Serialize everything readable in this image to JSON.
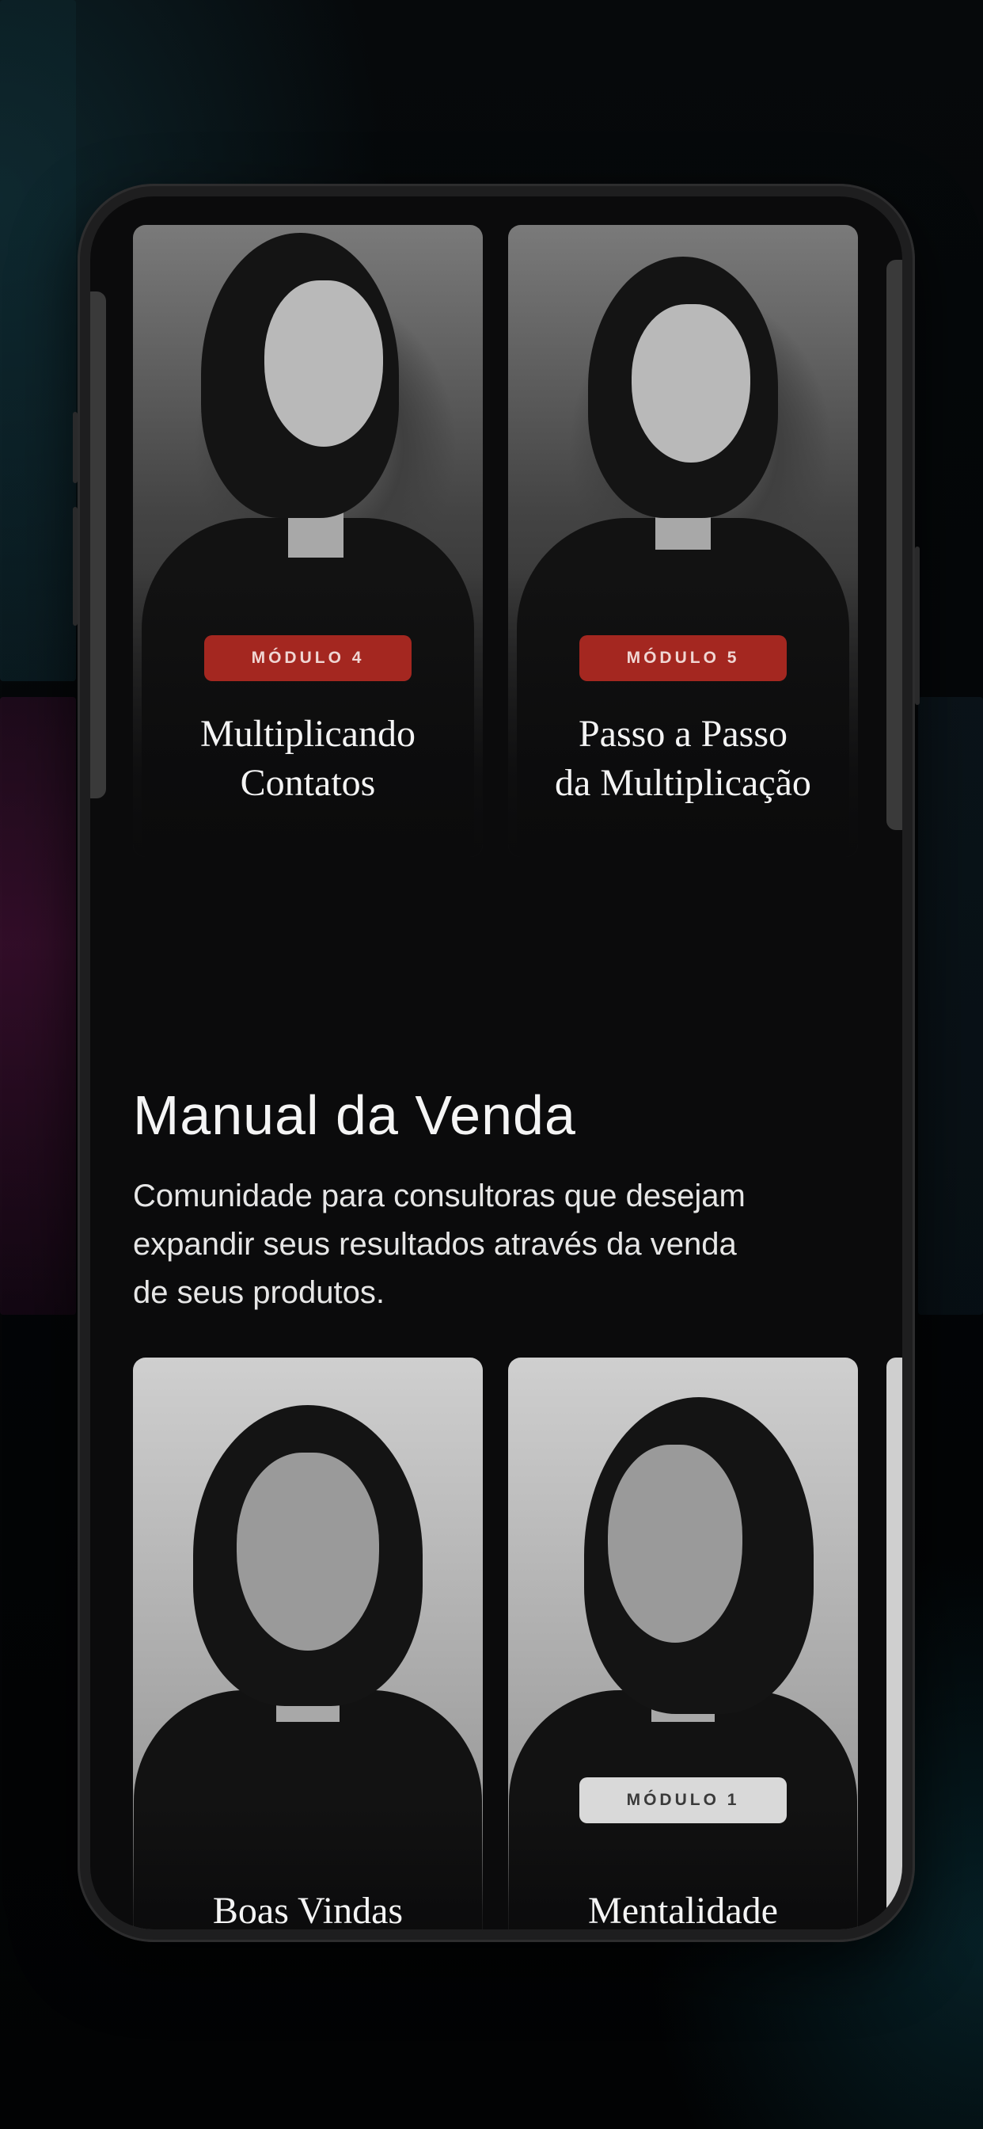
{
  "top_modules": [
    {
      "badge": "MÓDULO 4",
      "title_line1": "Multiplicando",
      "title_line2": "Contatos"
    },
    {
      "badge": "MÓDULO 5",
      "title_line1": "Passo a Passo",
      "title_line2": "da Multiplicação"
    }
  ],
  "section": {
    "title": "Manual da Venda",
    "description": "Comunidade para consultoras que desejam expandir seus resultados através da venda de seus produtos."
  },
  "bottom_modules": [
    {
      "badge": "",
      "title": "Boas Vindas"
    },
    {
      "badge": "MÓDULO 1",
      "title": "Mentalidade"
    }
  ],
  "colors": {
    "badge_red": "#a42720",
    "badge_light": "#d9d9d9",
    "screen_bg": "#0b0b0c"
  }
}
